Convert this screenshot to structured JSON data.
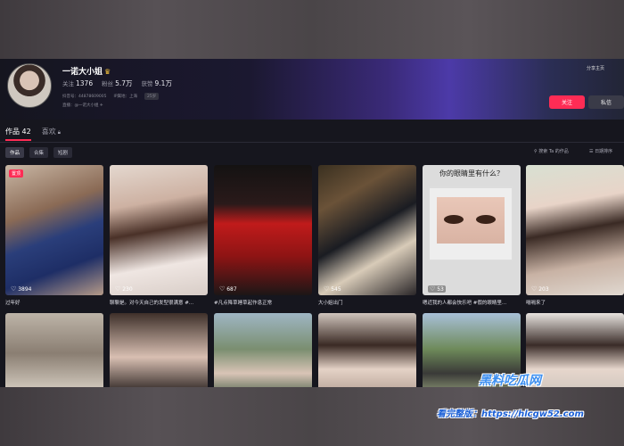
{
  "profile": {
    "name": "一诺大小姐",
    "crown_icon": "crown-icon",
    "stats": [
      {
        "label": "关注",
        "value": "1376"
      },
      {
        "label": "粉丝",
        "value": "5.7万"
      },
      {
        "label": "获赞",
        "value": "9.1万"
      }
    ],
    "douyin_id": "抖音号：44878609005",
    "ip_location": "IP属地：上海",
    "age_tag": "25岁",
    "live_line": "直播：@一诺大小姐 ✈"
  },
  "header_actions": {
    "share": "分享主页",
    "follow": "关注",
    "message": "私信"
  },
  "tabs": [
    {
      "label": "作品 42",
      "active": true
    },
    {
      "label": "喜欢",
      "active": false,
      "icon": "lock-icon"
    }
  ],
  "filters": [
    {
      "label": "作品",
      "active": true
    },
    {
      "label": "合集",
      "active": false
    },
    {
      "label": "短剧",
      "active": false
    }
  ],
  "tools": {
    "search": "⚲ 搜索 Ta 的作品",
    "sort": "☰ 日期排序"
  },
  "videos": [
    {
      "likes": "3894",
      "caption": "过年好",
      "pinned": "置顶"
    },
    {
      "likes": "230",
      "caption": "聊聊是。对今天自己的发型很满意 #..."
    },
    {
      "likes": "687",
      "caption": "#凡点降草睡草起作息正常"
    },
    {
      "likes": "545",
      "caption": "大小姐出门"
    },
    {
      "likes": "53",
      "caption": "嗯近我的人都会快乐吧 #假的眼睛里...",
      "banner": "你的眼睛里有什么？"
    },
    {
      "likes": "203",
      "caption": "嗝嗝来了"
    },
    {
      "likes": "",
      "caption": ""
    },
    {
      "likes": "",
      "caption": ""
    },
    {
      "likes": "",
      "caption": ""
    },
    {
      "likes": "",
      "caption": ""
    },
    {
      "likes": "",
      "caption": ""
    },
    {
      "likes": "",
      "caption": ""
    }
  ],
  "watermark": {
    "site": "黑料吃瓜网",
    "url": "看完整版：https://hlcgw52.com"
  }
}
